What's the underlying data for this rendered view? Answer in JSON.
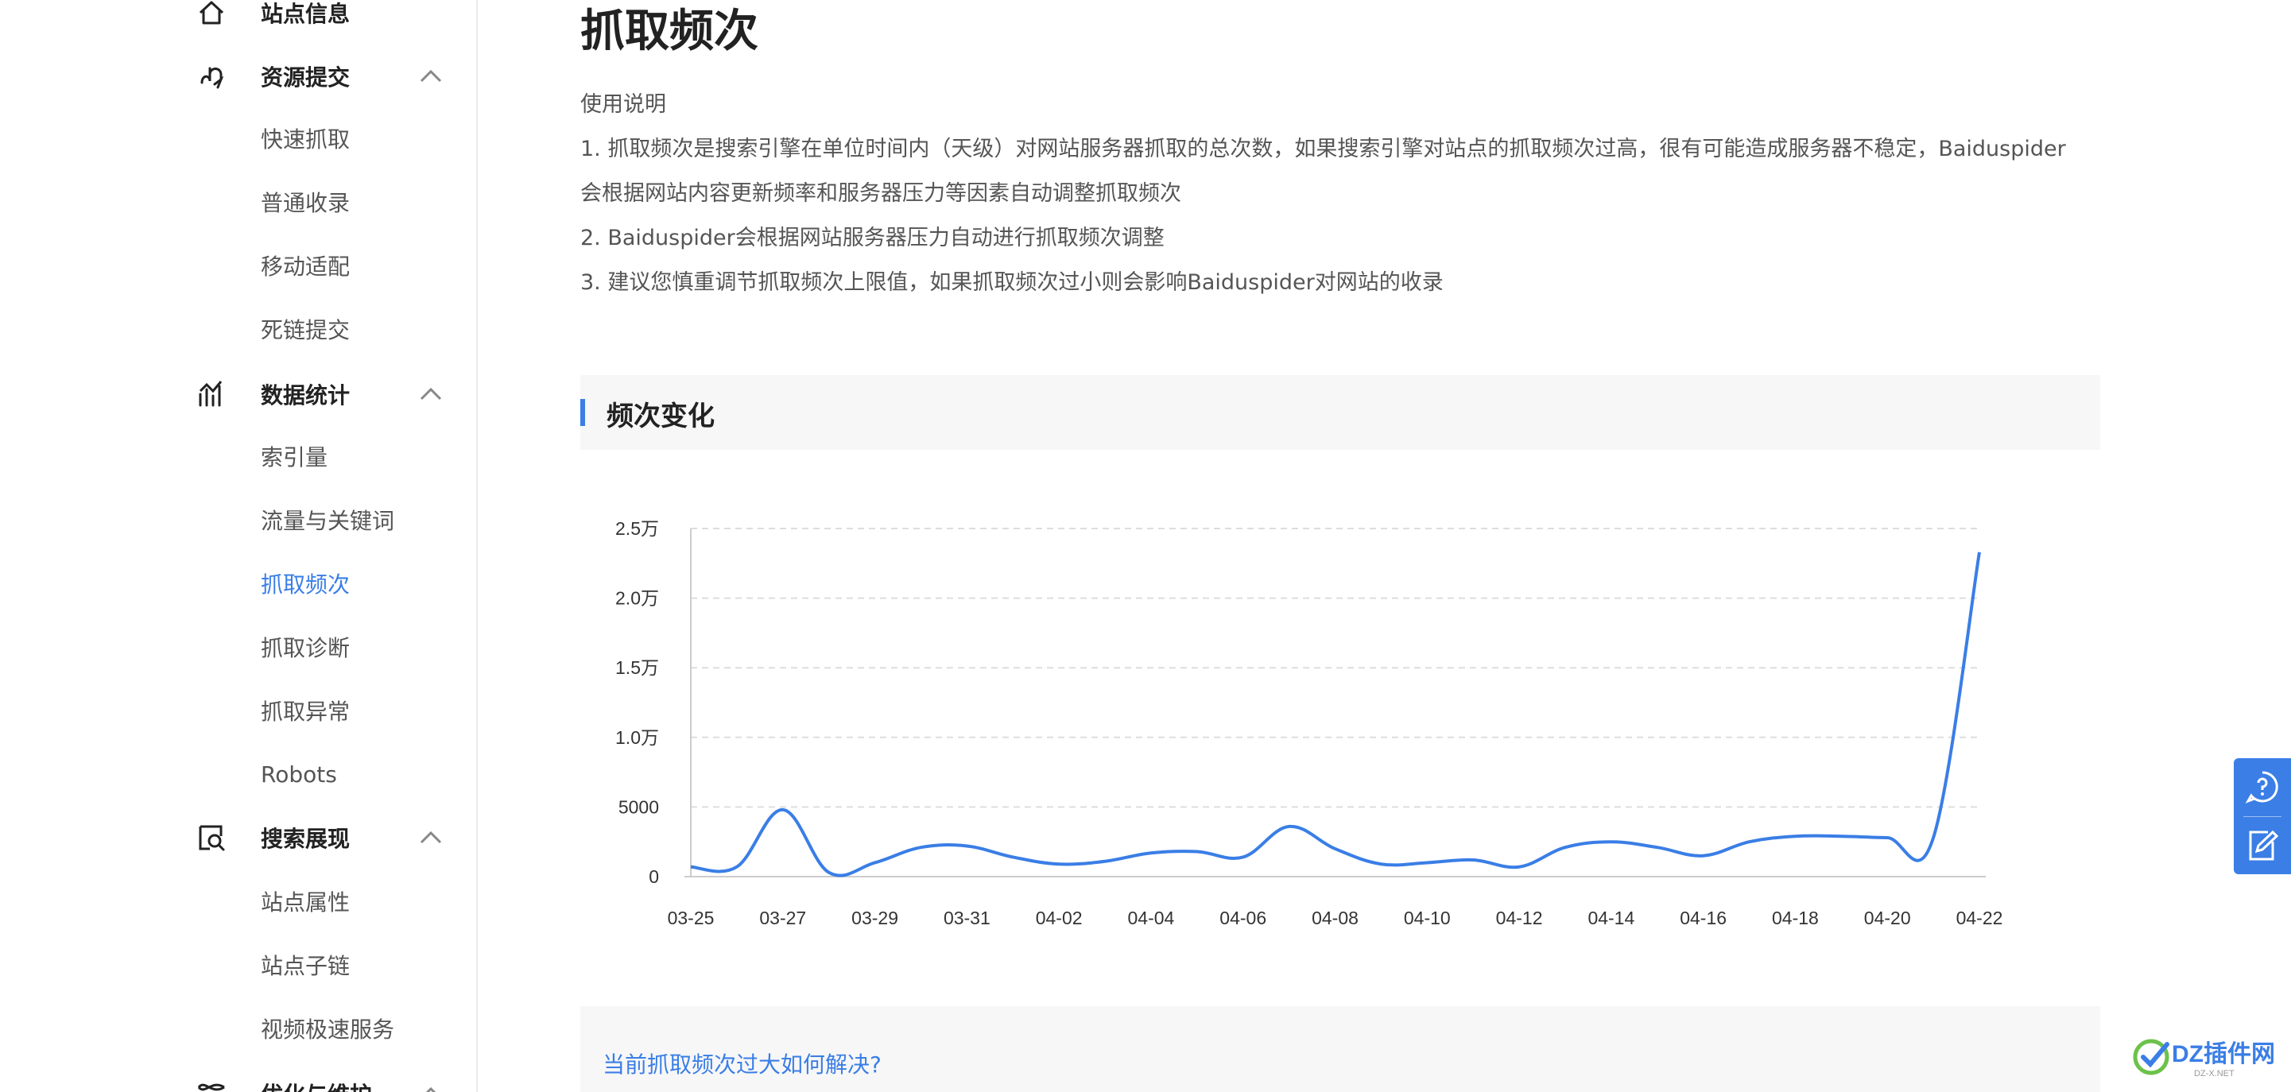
{
  "sidebar": {
    "site_info": "站点信息",
    "resource_submit": {
      "label": "资源提交",
      "items": [
        "快速抓取",
        "普通收录",
        "移动适配",
        "死链提交"
      ]
    },
    "data_stats": {
      "label": "数据统计",
      "items": [
        "索引量",
        "流量与关键词",
        "抓取频次",
        "抓取诊断",
        "抓取异常",
        "Robots"
      ]
    },
    "search_display": {
      "label": "搜索展现",
      "items": [
        "站点属性",
        "站点子链",
        "视频极速服务"
      ]
    },
    "optimize": "优化与维护",
    "active_item": "抓取频次",
    "accent_color": "#3a7ee6"
  },
  "main": {
    "title": "抓取频次",
    "usage_title": "使用说明",
    "usage_lines": [
      "1. 抓取频次是搜索引擎在单位时间内（天级）对网站服务器抓取的总次数，如果搜索引擎对站点的抓取频次过高，很有可能造成服务器不稳定，Baiduspider",
      "会根据网站内容更新频率和服务器压力等因素自动调整抓取频次",
      "2. Baiduspider会根据网站服务器压力自动进行抓取频次调整",
      "3. 建议您慎重调节抓取频次上限值，如果抓取频次过小则会影响Baiduspider对网站的收录"
    ],
    "section_title": "频次变化",
    "faq_link": "当前抓取频次过大如何解决?"
  },
  "chart_data": {
    "type": "line",
    "title": "",
    "xlabel": "",
    "ylabel": "",
    "ylim": [
      0,
      25000
    ],
    "y_ticks": [
      "0",
      "5000",
      "1.0万",
      "1.5万",
      "2.0万",
      "2.5万"
    ],
    "x_tick_labels": [
      "03-25",
      "03-27",
      "03-29",
      "03-31",
      "04-02",
      "04-04",
      "04-06",
      "04-08",
      "04-10",
      "04-12",
      "04-14",
      "04-16",
      "04-18",
      "04-20",
      "04-22"
    ],
    "grid": "horizontal dashed",
    "line_color": "#3a7ee6",
    "x": [
      "03-25",
      "03-26",
      "03-27",
      "03-28",
      "03-29",
      "03-30",
      "03-31",
      "04-01",
      "04-02",
      "04-03",
      "04-04",
      "04-05",
      "04-06",
      "04-07",
      "04-08",
      "04-09",
      "04-10",
      "04-11",
      "04-12",
      "04-13",
      "04-14",
      "04-15",
      "04-16",
      "04-17",
      "04-18",
      "04-19",
      "04-20",
      "04-21",
      "04-22"
    ],
    "series": [
      {
        "values": [
          700,
          700,
          4800,
          300,
          1000,
          2100,
          2200,
          1400,
          900,
          1100,
          1700,
          1800,
          1400,
          3600,
          2000,
          900,
          1000,
          1200,
          700,
          2100,
          2500,
          2100,
          1500,
          2500,
          2900,
          2900,
          2800,
          2800,
          23300
        ]
      }
    ]
  },
  "float_panel": {
    "help_icon": "question-chat-icon",
    "feedback_icon": "feedback-edit-icon"
  },
  "watermark": {
    "text": "DZ插件网",
    "sub": "DZ-X.NET"
  }
}
